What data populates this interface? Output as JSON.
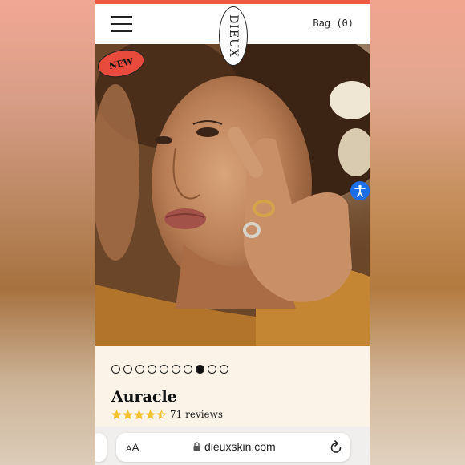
{
  "header": {
    "logo_text": "DIEUX",
    "bag_label": "Bag (0)"
  },
  "hero": {
    "badge_label": "NEW",
    "slide_count": 10,
    "active_slide": 8
  },
  "product": {
    "name": "Auracle",
    "rating": 4.5,
    "max_rating": 5,
    "review_count_label": "71 reviews"
  },
  "browser": {
    "text_size_label_small": "A",
    "text_size_label_large": "A",
    "url": "dieuxskin.com"
  },
  "colors": {
    "brand_red": "#ef5a43",
    "badge_red": "#e84b3c",
    "star_yellow": "#f2c230",
    "accessibility_blue": "#1d6ee6",
    "page_cream": "#fbf3e8"
  },
  "icons": {
    "menu": "hamburger-icon",
    "accessibility": "accessibility-icon",
    "lock": "lock-icon",
    "reload": "reload-icon",
    "star": "star-icon"
  }
}
